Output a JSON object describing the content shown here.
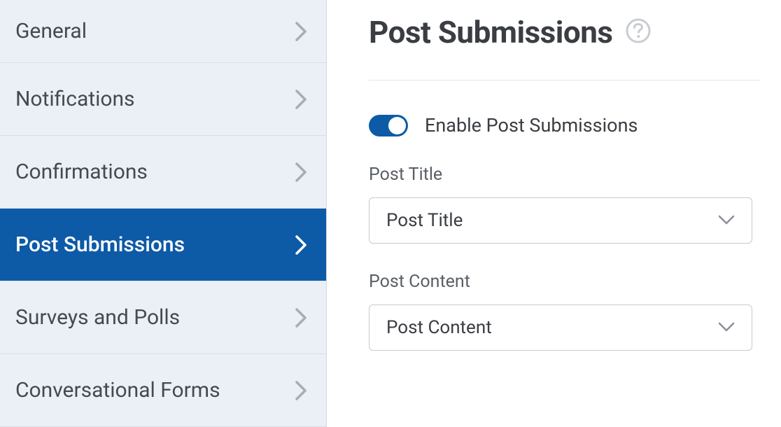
{
  "sidebar": {
    "items": [
      {
        "label": "General"
      },
      {
        "label": "Notifications"
      },
      {
        "label": "Confirmations"
      },
      {
        "label": "Post Submissions"
      },
      {
        "label": "Surveys and Polls"
      },
      {
        "label": "Conversational Forms"
      }
    ],
    "activeIndex": 3
  },
  "header": {
    "title": "Post Submissions"
  },
  "fields": {
    "enable_toggle": {
      "label": "Enable Post Submissions",
      "on": true
    },
    "post_title": {
      "label": "Post Title",
      "value": "Post Title"
    },
    "post_content": {
      "label": "Post Content",
      "value": "Post Content"
    }
  },
  "colors": {
    "accent": "#0d5aa7",
    "annotation": "#ff0000"
  }
}
